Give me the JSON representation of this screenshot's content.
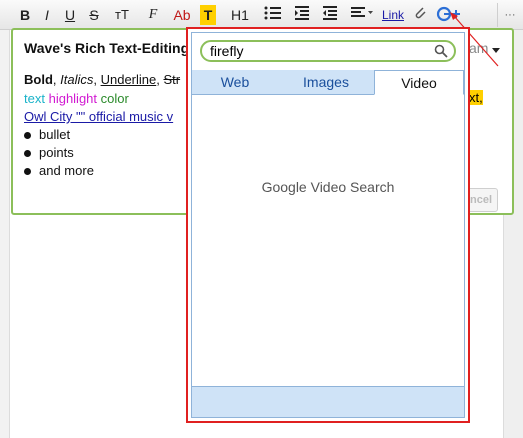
{
  "toolbar": {
    "bold": "B",
    "italic": "I",
    "underline": "U",
    "strike": "S",
    "font_size": "тT",
    "font_family": "F",
    "text_color": "Ab",
    "highlight": "T",
    "heading": "H1",
    "link": "Link",
    "more": "···"
  },
  "blip": {
    "title": "Wave's Rich Text-Editing",
    "line1_bold": "Bold",
    "line1_sep1": ", ",
    "line1_italic": "Italics",
    "line1_sep2": ", ",
    "line1_underline": "Underline",
    "line1_sep3": ", ",
    "line1_strike": "Str",
    "line2_text": "text",
    "line2_highlight": "highlight",
    "line2_color": "color",
    "line3_link": "Owl City \"\" official music v",
    "bullets": [
      "bullet",
      "points",
      "and more"
    ],
    "right_fragment_1": "am",
    "right_fragment_2": "xt,",
    "cancel_label": "Cancel"
  },
  "popup": {
    "search_value": "firefly",
    "tabs": [
      "Web",
      "Images",
      "Video"
    ],
    "active_tab": "Video",
    "message": "Google Video Search"
  },
  "colors": {
    "accent_green": "#8cbf5a",
    "popup_border": "#e02020",
    "tab_bg": "#cfe3f7",
    "link_blue": "#1a1aa6",
    "cyan_text": "#1ab3c9",
    "magenta_text": "#d11ad1",
    "green_text": "#2a8a2a",
    "highlight_yellow": "#ffd000"
  },
  "icons": [
    "search-icon",
    "paperclip-icon",
    "google-plus-icon",
    "list-icon",
    "indent-icon",
    "outdent-icon",
    "align-icon",
    "dropdown-caret-icon"
  ]
}
